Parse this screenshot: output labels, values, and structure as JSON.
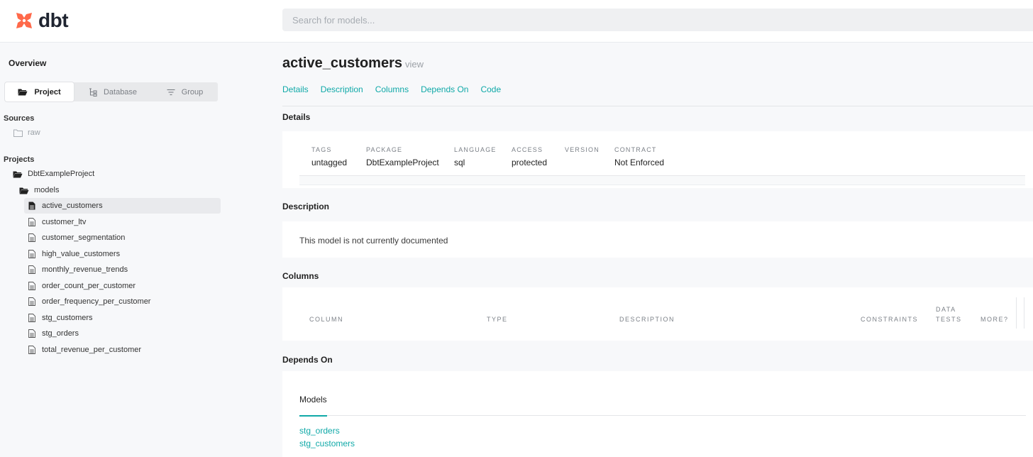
{
  "header": {
    "logo_text": "dbt",
    "brand_color": "#ff694a",
    "search_placeholder": "Search for models..."
  },
  "sidebar": {
    "overview_label": "Overview",
    "tabs": [
      {
        "label": "Project",
        "icon": "folder-open-icon",
        "active": true
      },
      {
        "label": "Database",
        "icon": "database-tree-icon",
        "active": false
      },
      {
        "label": "Group",
        "icon": "group-lines-icon",
        "active": false
      }
    ],
    "sources_heading": "Sources",
    "sources": [
      {
        "label": "raw",
        "icon": "folder-icon"
      }
    ],
    "projects_heading": "Projects",
    "project_name": "DbtExampleProject",
    "models_folder": "models",
    "models": [
      {
        "label": "active_customers",
        "active": true
      },
      {
        "label": "customer_ltv"
      },
      {
        "label": "customer_segmentation"
      },
      {
        "label": "high_value_customers"
      },
      {
        "label": "monthly_revenue_trends"
      },
      {
        "label": "order_count_per_customer"
      },
      {
        "label": "order_frequency_per_customer"
      },
      {
        "label": "stg_customers"
      },
      {
        "label": "stg_orders"
      },
      {
        "label": "total_revenue_per_customer"
      }
    ]
  },
  "main": {
    "title": "active_customers",
    "title_type": "view",
    "nav": [
      "Details",
      "Description",
      "Columns",
      "Depends On",
      "Code"
    ],
    "details": {
      "heading": "Details",
      "fields": [
        {
          "label": "TAGS",
          "value": "untagged"
        },
        {
          "label": "PACKAGE",
          "value": "DbtExampleProject"
        },
        {
          "label": "LANGUAGE",
          "value": "sql"
        },
        {
          "label": "ACCESS",
          "value": "protected"
        },
        {
          "label": "VERSION",
          "value": ""
        },
        {
          "label": "CONTRACT",
          "value": "Not Enforced"
        }
      ]
    },
    "description": {
      "heading": "Description",
      "text": "This model is not currently documented"
    },
    "columns": {
      "heading": "Columns",
      "headers": {
        "column": "COLUMN",
        "type": "TYPE",
        "description": "DESCRIPTION",
        "constraints": "CONSTRAINTS",
        "data_tests_1": "DATA",
        "data_tests_2": "TESTS",
        "more": "MORE?"
      }
    },
    "depends_on": {
      "heading": "Depends On",
      "tab_label": "Models",
      "links": [
        "stg_orders",
        "stg_customers"
      ]
    }
  },
  "colors": {
    "accent": "#10a9a8",
    "brand": "#ff694a",
    "background": "#f7f8fa"
  }
}
